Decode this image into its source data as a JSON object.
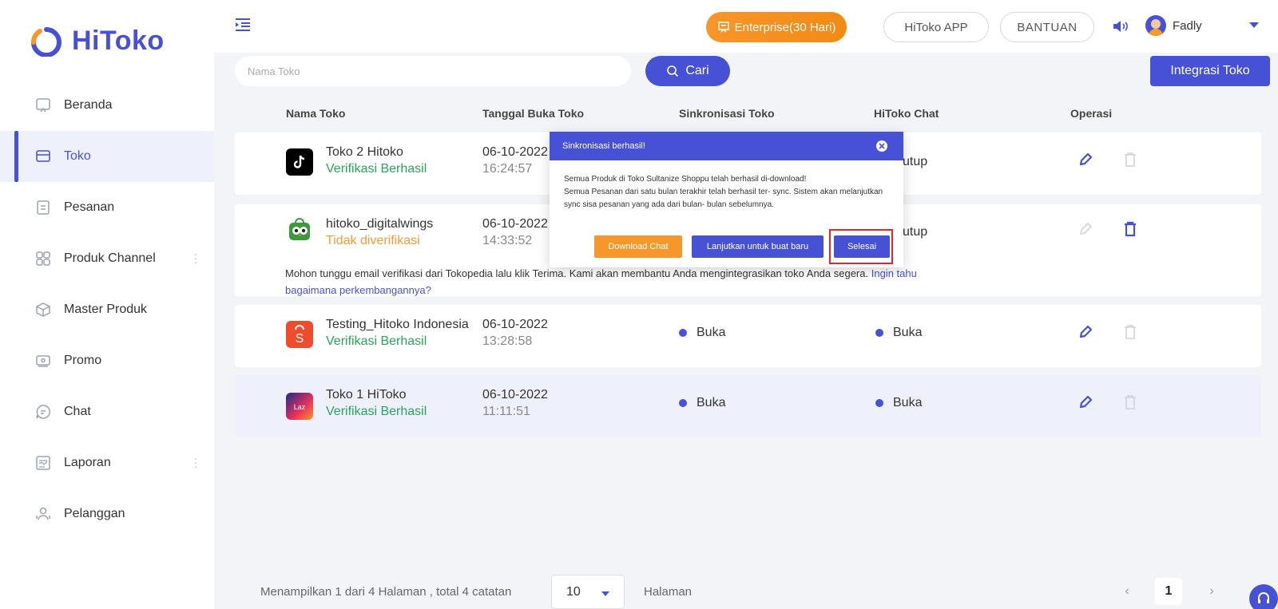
{
  "brand": {
    "name": "HiToko",
    "accent": "#4651d6",
    "orange": "#f7962a"
  },
  "sidebar": {
    "items": [
      {
        "label": "Beranda",
        "icon": "home-icon",
        "active": false
      },
      {
        "label": "Toko",
        "icon": "store-icon",
        "active": true
      },
      {
        "label": "Pesanan",
        "icon": "order-icon",
        "active": false
      },
      {
        "label": "Produk Channel",
        "icon": "grid-icon",
        "active": false,
        "more": true
      },
      {
        "label": "Master Produk",
        "icon": "box-icon",
        "active": false
      },
      {
        "label": "Promo",
        "icon": "promo-icon",
        "active": false
      },
      {
        "label": "Chat",
        "icon": "chat-icon",
        "active": false
      },
      {
        "label": "Laporan",
        "icon": "report-icon",
        "active": false,
        "more": true
      },
      {
        "label": "Pelanggan",
        "icon": "customers-icon",
        "active": false
      }
    ]
  },
  "topbar": {
    "enterprise": "Enterprise(30 Hari)",
    "app": "HiToko APP",
    "help": "BANTUAN",
    "user": "Fadly"
  },
  "search": {
    "placeholder": "Nama Toko",
    "button": "Cari",
    "integrate": "Integrasi Toko"
  },
  "table": {
    "headers": [
      "Nama Toko",
      "Tanggal Buka Toko",
      "Sinkronisasi Toko",
      "HiToko Chat",
      "Operasi"
    ],
    "rows": [
      {
        "name": "Toko 2 Hitoko",
        "status": "Verifikasi Berhasil",
        "date": "06-10-2022",
        "time": "16:24:57",
        "sync": "",
        "chat": "utup"
      },
      {
        "name": "hitoko_digitalwings",
        "status": "Tidak diverifikasi",
        "date": "06-10-2022",
        "time": "14:33:52",
        "sync": "",
        "chat": "utup",
        "note": "Mohon tunggu email verifikasi dari Tokopedia lalu klik Terima. Kami akan membantu Anda mengintegrasikan toko Anda segera.",
        "note_link": "Ingin tahu bagaimana perkembangannya?"
      },
      {
        "name": "Testing_Hitoko Indonesia",
        "status": "Verifikasi Berhasil",
        "date": "06-10-2022",
        "time": "13:28:58",
        "sync": "Buka",
        "chat": "Buka"
      },
      {
        "name": "Toko 1 HiToko",
        "status": "Verifikasi Berhasil",
        "date": "06-10-2022",
        "time": "11:11:51",
        "sync": "Buka",
        "chat": "Buka"
      }
    ]
  },
  "pagination": {
    "summary": "Menampilkan 1 dari 4 Halaman , total 4 catatan",
    "page_size": "10",
    "page_label": "Halaman",
    "current": "1",
    "prev": "‹",
    "next": "›"
  },
  "modal": {
    "title": "Sinkronisasi berhasil!",
    "line1": "Semua Produk di Toko Sultanize Shoppu telah berhasil di-download!",
    "line2": "Semua Pesanan dari satu bulan terakhir telah berhasil ter- sync. Sistem akan melanjutkan sync sisa pesanan yang ada dari bulan- bulan sebelumnya.",
    "btn_download": "Download Chat",
    "btn_continue": "Lanjutkan untuk buat baru",
    "btn_done": "Selesai"
  }
}
